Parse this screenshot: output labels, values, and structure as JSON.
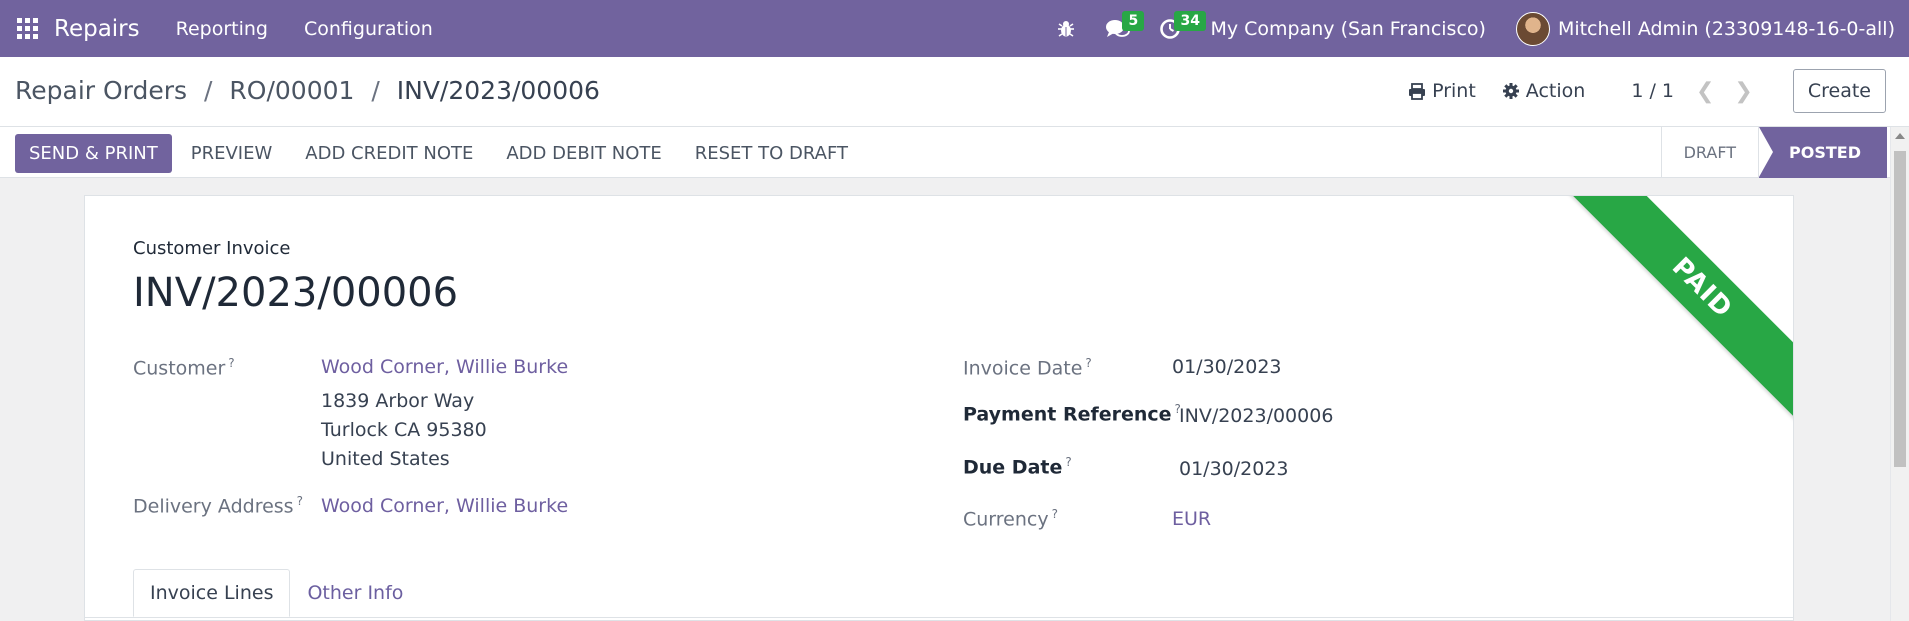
{
  "navbar": {
    "app_name": "Repairs",
    "menu": [
      "Reporting",
      "Configuration"
    ],
    "messages_count": "5",
    "activities_count": "34",
    "company": "My Company (San Francisco)",
    "user": "Mitchell Admin (23309148-16-0-all)",
    "bg_color": "#71639e"
  },
  "breadcrumb": {
    "items": [
      "Repair Orders",
      "RO/00001",
      "INV/2023/00006"
    ],
    "separator": "/"
  },
  "control": {
    "print_label": "Print",
    "action_label": "Action",
    "pager": "1 / 1",
    "create_label": "Create"
  },
  "statusbar": {
    "buttons": [
      "SEND & PRINT",
      "PREVIEW",
      "ADD CREDIT NOTE",
      "ADD DEBIT NOTE",
      "RESET TO DRAFT"
    ],
    "stages": [
      "DRAFT",
      "POSTED"
    ],
    "active_stage": "POSTED"
  },
  "invoice": {
    "type": "Customer Invoice",
    "number": "INV/2023/00006",
    "ribbon": "PAID",
    "ribbon_color": "#28a745",
    "customer_label": "Customer",
    "customer_name": "Wood Corner, Willie Burke",
    "address_line1": "1839 Arbor Way",
    "address_line2": "Turlock CA 95380",
    "address_line3": "United States",
    "delivery_label": "Delivery Address",
    "delivery_value": "Wood Corner, Willie Burke",
    "invoice_date_label": "Invoice Date",
    "invoice_date": "01/30/2023",
    "payment_ref_label": "Payment Reference",
    "payment_ref": "INV/2023/00006",
    "due_date_label": "Due Date",
    "due_date": "01/30/2023",
    "currency_label": "Currency",
    "currency": "EUR",
    "help_mark": "?"
  },
  "tabs": [
    "Invoice Lines",
    "Other Info"
  ]
}
